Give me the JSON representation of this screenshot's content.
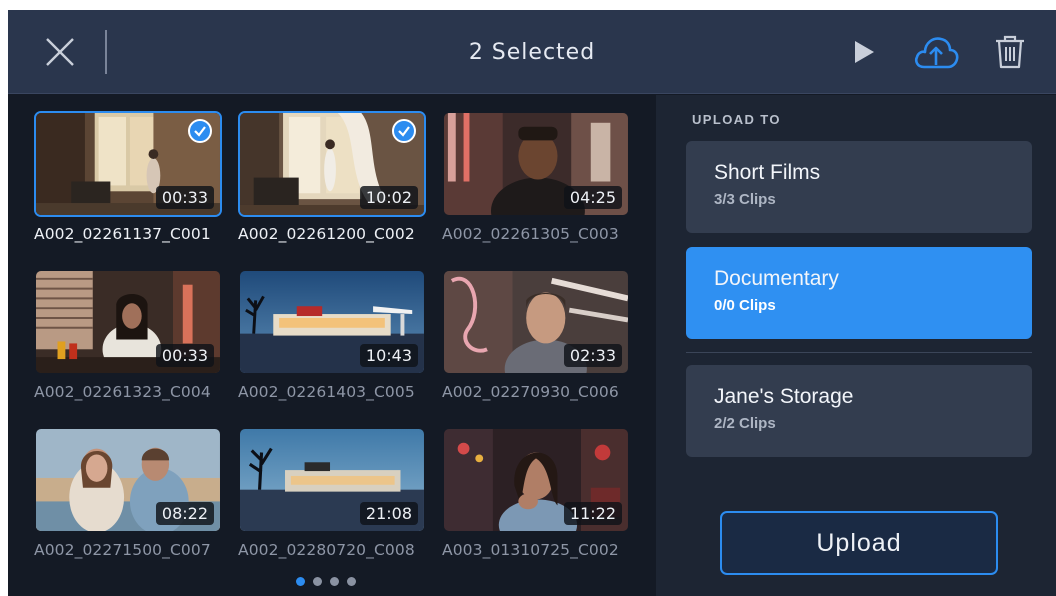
{
  "header": {
    "title": "2 Selected",
    "icons": {
      "close": "close-icon",
      "play": "play-icon",
      "upload": "cloud-upload-icon",
      "delete": "trash-icon"
    }
  },
  "clips": [
    {
      "name": "A002_02261137_C001",
      "duration": "00:33",
      "selected": true
    },
    {
      "name": "A002_02261200_C002",
      "duration": "10:02",
      "selected": true
    },
    {
      "name": "A002_02261305_C003",
      "duration": "04:25",
      "selected": false
    },
    {
      "name": "A002_02261323_C004",
      "duration": "00:33",
      "selected": false
    },
    {
      "name": "A002_02261403_C005",
      "duration": "10:43",
      "selected": false
    },
    {
      "name": "A002_02270930_C006",
      "duration": "02:33",
      "selected": false
    },
    {
      "name": "A002_02271500_C007",
      "duration": "08:22",
      "selected": false
    },
    {
      "name": "A002_02280720_C008",
      "duration": "21:08",
      "selected": false
    },
    {
      "name": "A003_01310725_C002",
      "duration": "11:22",
      "selected": false
    }
  ],
  "pager": {
    "pages": 4,
    "current": 1
  },
  "upload_panel": {
    "label": "UPLOAD TO",
    "destinations": [
      {
        "name": "Short Films",
        "count": "3/3 Clips",
        "active": false
      },
      {
        "name": "Documentary",
        "count": "0/0 Clips",
        "active": true
      },
      {
        "name": "Jane's Storage",
        "count": "2/2 Clips",
        "active": false
      }
    ],
    "button_label": "Upload"
  },
  "colors": {
    "accent": "#2c8cf0",
    "header_bg": "#2a364d",
    "panel_bg": "#1d2533",
    "grid_bg": "#141a25"
  }
}
